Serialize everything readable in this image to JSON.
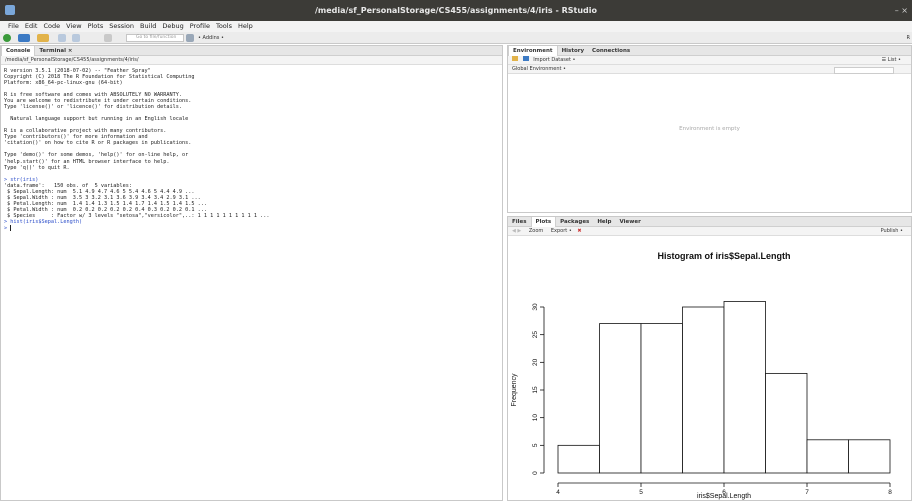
{
  "window": {
    "title": "/media/sf_PersonalStorage/CS455/assignments/4/iris - RStudio",
    "controls": "– ×"
  },
  "menu": [
    "File",
    "Edit",
    "Code",
    "View",
    "Plots",
    "Session",
    "Build",
    "Debug",
    "Profile",
    "Tools",
    "Help"
  ],
  "toolbar": {
    "goto_placeholder": "Go to file/function",
    "addins_label": "• Addins •",
    "project_label": "R"
  },
  "console_pane": {
    "tabs": [
      "Console",
      "Terminal ×"
    ],
    "path": "/media/sf_PersonalStorage/CS455/assignments/4/iris/",
    "lines": [
      {
        "text": "R version 3.5.1 (2018-07-02) -- \"Feather Spray\"",
        "type": "out"
      },
      {
        "text": "Copyright (C) 2018 The R Foundation for Statistical Computing",
        "type": "out"
      },
      {
        "text": "Platform: x86_64-pc-linux-gnu (64-bit)",
        "type": "out"
      },
      {
        "text": "",
        "type": "gap"
      },
      {
        "text": "R is free software and comes with ABSOLUTELY NO WARRANTY.",
        "type": "out"
      },
      {
        "text": "You are welcome to redistribute it under certain conditions.",
        "type": "out"
      },
      {
        "text": "Type 'license()' or 'licence()' for distribution details.",
        "type": "out"
      },
      {
        "text": "",
        "type": "gap"
      },
      {
        "text": "  Natural language support but running in an English locale",
        "type": "out"
      },
      {
        "text": "",
        "type": "gap"
      },
      {
        "text": "R is a collaborative project with many contributors.",
        "type": "out"
      },
      {
        "text": "Type 'contributors()' for more information and",
        "type": "out"
      },
      {
        "text": "'citation()' on how to cite R or R packages in publications.",
        "type": "out"
      },
      {
        "text": "",
        "type": "gap"
      },
      {
        "text": "Type 'demo()' for some demos, 'help()' for on-line help, or",
        "type": "out"
      },
      {
        "text": "'help.start()' for an HTML browser interface to help.",
        "type": "out"
      },
      {
        "text": "Type 'q()' to quit R.",
        "type": "out"
      },
      {
        "text": "",
        "type": "gap"
      },
      {
        "text": "> str(iris)",
        "type": "cmd"
      },
      {
        "text": "'data.frame':   150 obs. of  5 variables:",
        "type": "out"
      },
      {
        "text": " $ Sepal.Length: num  5.1 4.9 4.7 4.6 5 5.4 4.6 5 4.4 4.9 ...",
        "type": "out"
      },
      {
        "text": " $ Sepal.Width : num  3.5 3 3.2 3.1 3.6 3.9 3.4 3.4 2.9 3.1 ...",
        "type": "out"
      },
      {
        "text": " $ Petal.Length: num  1.4 1.4 1.3 1.5 1.4 1.7 1.4 1.5 1.4 1.5 ...",
        "type": "out"
      },
      {
        "text": " $ Petal.Width : num  0.2 0.2 0.2 0.2 0.2 0.4 0.3 0.2 0.2 0.1 ...",
        "type": "out"
      },
      {
        "text": " $ Species     : Factor w/ 3 levels \"setosa\",\"versicolor\",..: 1 1 1 1 1 1 1 1 1 1 ...",
        "type": "out"
      },
      {
        "text": "> hist(iris$Sepal.Length)",
        "type": "cmd"
      },
      {
        "text": "> ",
        "type": "prompt"
      }
    ]
  },
  "env_pane": {
    "tabs": [
      "Environment",
      "History",
      "Connections"
    ],
    "import_label": "Import Dataset •",
    "list_label": "☰ List •",
    "global_env_label": "Global Environment •",
    "empty_message": "Environment is empty"
  },
  "plots_pane": {
    "tabs": [
      "Files",
      "Plots",
      "Packages",
      "Help",
      "Viewer"
    ],
    "zoom_label": "Zoom",
    "export_label": "Export •",
    "publish_label": "Publish •"
  },
  "colors": {
    "titlebar": "#3c3b37",
    "accent": "#2a4cc9"
  },
  "chart_data": {
    "type": "bar",
    "title": "Histogram of iris$Sepal.Length",
    "xlabel": "iris$Sepal.Length",
    "ylabel": "Frequency",
    "bins": [
      [
        4,
        4.5
      ],
      [
        4.5,
        5
      ],
      [
        5,
        5.5
      ],
      [
        5.5,
        6
      ],
      [
        6,
        6.5
      ],
      [
        6.5,
        7
      ],
      [
        7,
        7.5
      ],
      [
        7.5,
        8
      ]
    ],
    "values": [
      5,
      27,
      27,
      30,
      31,
      18,
      6,
      6
    ],
    "xlim": [
      4,
      8
    ],
    "ylim": [
      0,
      30
    ],
    "xticks": [
      4,
      5,
      6,
      7,
      8
    ],
    "yticks": [
      0,
      5,
      10,
      15,
      20,
      25,
      30
    ],
    "grid": false
  }
}
